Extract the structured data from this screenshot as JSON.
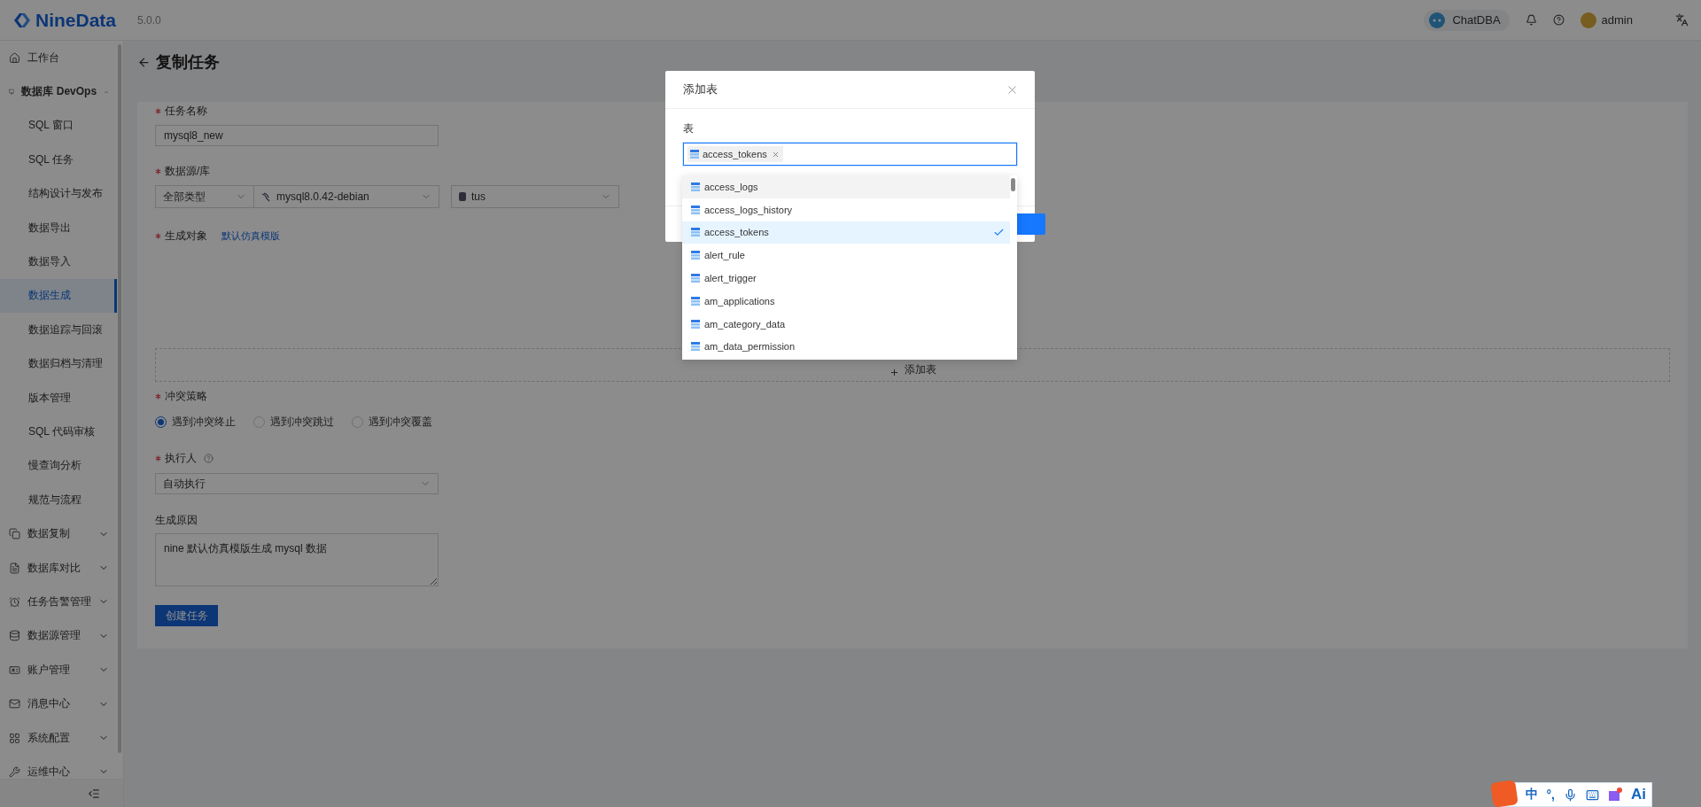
{
  "header": {
    "logo_text": "NineData",
    "version": "5.0.0",
    "chat_button": "ChatDBA",
    "user_name": "admin"
  },
  "sidebar": {
    "items": [
      {
        "label": "工作台"
      },
      {
        "label": "数据库 DevOps",
        "expanded": true,
        "children": [
          {
            "label": "SQL 窗口",
            "selected": false
          },
          {
            "label": "SQL 任务",
            "selected": false
          },
          {
            "label": "结构设计与发布",
            "selected": false
          },
          {
            "label": "数据导出",
            "selected": false
          },
          {
            "label": "数据导入",
            "selected": false
          },
          {
            "label": "数据生成",
            "selected": true
          },
          {
            "label": "数据追踪与回滚",
            "selected": false
          },
          {
            "label": "数据归档与清理",
            "selected": false
          },
          {
            "label": "版本管理",
            "selected": false
          },
          {
            "label": "SQL 代码审核",
            "selected": false
          },
          {
            "label": "慢查询分析",
            "selected": false
          },
          {
            "label": "规范与流程",
            "selected": false
          }
        ]
      },
      {
        "label": "数据复制",
        "expanded": false
      },
      {
        "label": "数据库对比",
        "expanded": false
      },
      {
        "label": "任务告警管理",
        "expanded": false
      },
      {
        "label": "数据源管理",
        "expanded": false
      },
      {
        "label": "账户管理",
        "expanded": false
      },
      {
        "label": "消息中心",
        "expanded": false
      },
      {
        "label": "系统配置",
        "expanded": false
      },
      {
        "label": "运维中心",
        "expanded": false
      }
    ]
  },
  "page_title": "复制任务",
  "form": {
    "task_name": {
      "label": "任务名称",
      "required": true,
      "value": "mysql8_new"
    },
    "source": {
      "label": "数据源/库",
      "required": true,
      "type_select": "全部类型",
      "instance": "mysql8.0.42-debian",
      "database": "tus"
    },
    "objects": {
      "label": "生成对象",
      "required": true,
      "link": "默认仿真模版",
      "add_button": "添加表"
    },
    "conflict": {
      "label": "冲突策略",
      "required": true,
      "options": [
        {
          "label": "遇到冲突终止",
          "selected": true
        },
        {
          "label": "遇到冲突跳过",
          "selected": false
        },
        {
          "label": "遇到冲突覆盖",
          "selected": false
        }
      ]
    },
    "executor": {
      "label": "执行人",
      "required": true,
      "value": "自动执行"
    },
    "reason": {
      "label": "生成原因",
      "required": false,
      "value": "nine 默认仿真模版生成 mysql 数据"
    },
    "submit": "创建任务"
  },
  "dialog": {
    "title": "添加表",
    "field_label": "表",
    "tags": [
      {
        "label": "access_tokens"
      }
    ],
    "options": [
      {
        "label": "access_logs",
        "highlighted": true,
        "selected": false
      },
      {
        "label": "access_logs_history",
        "highlighted": false,
        "selected": false
      },
      {
        "label": "access_tokens",
        "highlighted": false,
        "selected": true
      },
      {
        "label": "alert_rule",
        "highlighted": false,
        "selected": false
      },
      {
        "label": "alert_trigger",
        "highlighted": false,
        "selected": false
      },
      {
        "label": "am_applications",
        "highlighted": false,
        "selected": false
      },
      {
        "label": "am_category_data",
        "highlighted": false,
        "selected": false
      },
      {
        "label": "am_data_permission",
        "highlighted": false,
        "selected": false
      }
    ]
  },
  "ime_toolbar": {
    "mode": "中",
    "punctuation": "°,",
    "ai": "Ai"
  }
}
